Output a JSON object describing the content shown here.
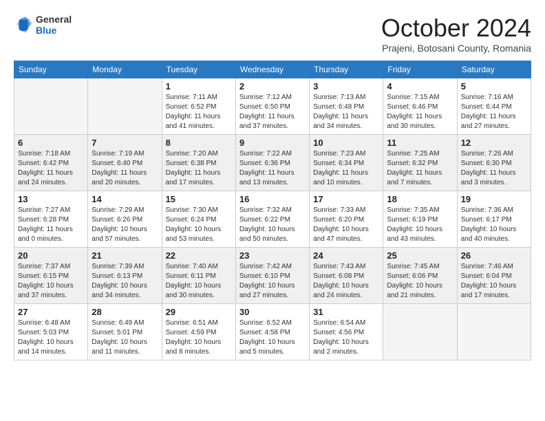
{
  "header": {
    "logo_general": "General",
    "logo_blue": "Blue",
    "month_title": "October 2024",
    "location": "Prajeni, Botosani County, Romania"
  },
  "weekdays": [
    "Sunday",
    "Monday",
    "Tuesday",
    "Wednesday",
    "Thursday",
    "Friday",
    "Saturday"
  ],
  "weeks": [
    {
      "shaded": false,
      "days": [
        {
          "num": "",
          "detail": ""
        },
        {
          "num": "",
          "detail": ""
        },
        {
          "num": "1",
          "detail": "Sunrise: 7:11 AM\nSunset: 6:52 PM\nDaylight: 11 hours\nand 41 minutes."
        },
        {
          "num": "2",
          "detail": "Sunrise: 7:12 AM\nSunset: 6:50 PM\nDaylight: 11 hours\nand 37 minutes."
        },
        {
          "num": "3",
          "detail": "Sunrise: 7:13 AM\nSunset: 6:48 PM\nDaylight: 11 hours\nand 34 minutes."
        },
        {
          "num": "4",
          "detail": "Sunrise: 7:15 AM\nSunset: 6:46 PM\nDaylight: 11 hours\nand 30 minutes."
        },
        {
          "num": "5",
          "detail": "Sunrise: 7:16 AM\nSunset: 6:44 PM\nDaylight: 11 hours\nand 27 minutes."
        }
      ]
    },
    {
      "shaded": true,
      "days": [
        {
          "num": "6",
          "detail": "Sunrise: 7:18 AM\nSunset: 6:42 PM\nDaylight: 11 hours\nand 24 minutes."
        },
        {
          "num": "7",
          "detail": "Sunrise: 7:19 AM\nSunset: 6:40 PM\nDaylight: 11 hours\nand 20 minutes."
        },
        {
          "num": "8",
          "detail": "Sunrise: 7:20 AM\nSunset: 6:38 PM\nDaylight: 11 hours\nand 17 minutes."
        },
        {
          "num": "9",
          "detail": "Sunrise: 7:22 AM\nSunset: 6:36 PM\nDaylight: 11 hours\nand 13 minutes."
        },
        {
          "num": "10",
          "detail": "Sunrise: 7:23 AM\nSunset: 6:34 PM\nDaylight: 11 hours\nand 10 minutes."
        },
        {
          "num": "11",
          "detail": "Sunrise: 7:25 AM\nSunset: 6:32 PM\nDaylight: 11 hours\nand 7 minutes."
        },
        {
          "num": "12",
          "detail": "Sunrise: 7:26 AM\nSunset: 6:30 PM\nDaylight: 11 hours\nand 3 minutes."
        }
      ]
    },
    {
      "shaded": false,
      "days": [
        {
          "num": "13",
          "detail": "Sunrise: 7:27 AM\nSunset: 6:28 PM\nDaylight: 11 hours\nand 0 minutes."
        },
        {
          "num": "14",
          "detail": "Sunrise: 7:29 AM\nSunset: 6:26 PM\nDaylight: 10 hours\nand 57 minutes."
        },
        {
          "num": "15",
          "detail": "Sunrise: 7:30 AM\nSunset: 6:24 PM\nDaylight: 10 hours\nand 53 minutes."
        },
        {
          "num": "16",
          "detail": "Sunrise: 7:32 AM\nSunset: 6:22 PM\nDaylight: 10 hours\nand 50 minutes."
        },
        {
          "num": "17",
          "detail": "Sunrise: 7:33 AM\nSunset: 6:20 PM\nDaylight: 10 hours\nand 47 minutes."
        },
        {
          "num": "18",
          "detail": "Sunrise: 7:35 AM\nSunset: 6:19 PM\nDaylight: 10 hours\nand 43 minutes."
        },
        {
          "num": "19",
          "detail": "Sunrise: 7:36 AM\nSunset: 6:17 PM\nDaylight: 10 hours\nand 40 minutes."
        }
      ]
    },
    {
      "shaded": true,
      "days": [
        {
          "num": "20",
          "detail": "Sunrise: 7:37 AM\nSunset: 6:15 PM\nDaylight: 10 hours\nand 37 minutes."
        },
        {
          "num": "21",
          "detail": "Sunrise: 7:39 AM\nSunset: 6:13 PM\nDaylight: 10 hours\nand 34 minutes."
        },
        {
          "num": "22",
          "detail": "Sunrise: 7:40 AM\nSunset: 6:11 PM\nDaylight: 10 hours\nand 30 minutes."
        },
        {
          "num": "23",
          "detail": "Sunrise: 7:42 AM\nSunset: 6:10 PM\nDaylight: 10 hours\nand 27 minutes."
        },
        {
          "num": "24",
          "detail": "Sunrise: 7:43 AM\nSunset: 6:08 PM\nDaylight: 10 hours\nand 24 minutes."
        },
        {
          "num": "25",
          "detail": "Sunrise: 7:45 AM\nSunset: 6:06 PM\nDaylight: 10 hours\nand 21 minutes."
        },
        {
          "num": "26",
          "detail": "Sunrise: 7:46 AM\nSunset: 6:04 PM\nDaylight: 10 hours\nand 17 minutes."
        }
      ]
    },
    {
      "shaded": false,
      "days": [
        {
          "num": "27",
          "detail": "Sunrise: 6:48 AM\nSunset: 5:03 PM\nDaylight: 10 hours\nand 14 minutes."
        },
        {
          "num": "28",
          "detail": "Sunrise: 6:49 AM\nSunset: 5:01 PM\nDaylight: 10 hours\nand 11 minutes."
        },
        {
          "num": "29",
          "detail": "Sunrise: 6:51 AM\nSunset: 4:59 PM\nDaylight: 10 hours\nand 8 minutes."
        },
        {
          "num": "30",
          "detail": "Sunrise: 6:52 AM\nSunset: 4:58 PM\nDaylight: 10 hours\nand 5 minutes."
        },
        {
          "num": "31",
          "detail": "Sunrise: 6:54 AM\nSunset: 4:56 PM\nDaylight: 10 hours\nand 2 minutes."
        },
        {
          "num": "",
          "detail": ""
        },
        {
          "num": "",
          "detail": ""
        }
      ]
    }
  ]
}
